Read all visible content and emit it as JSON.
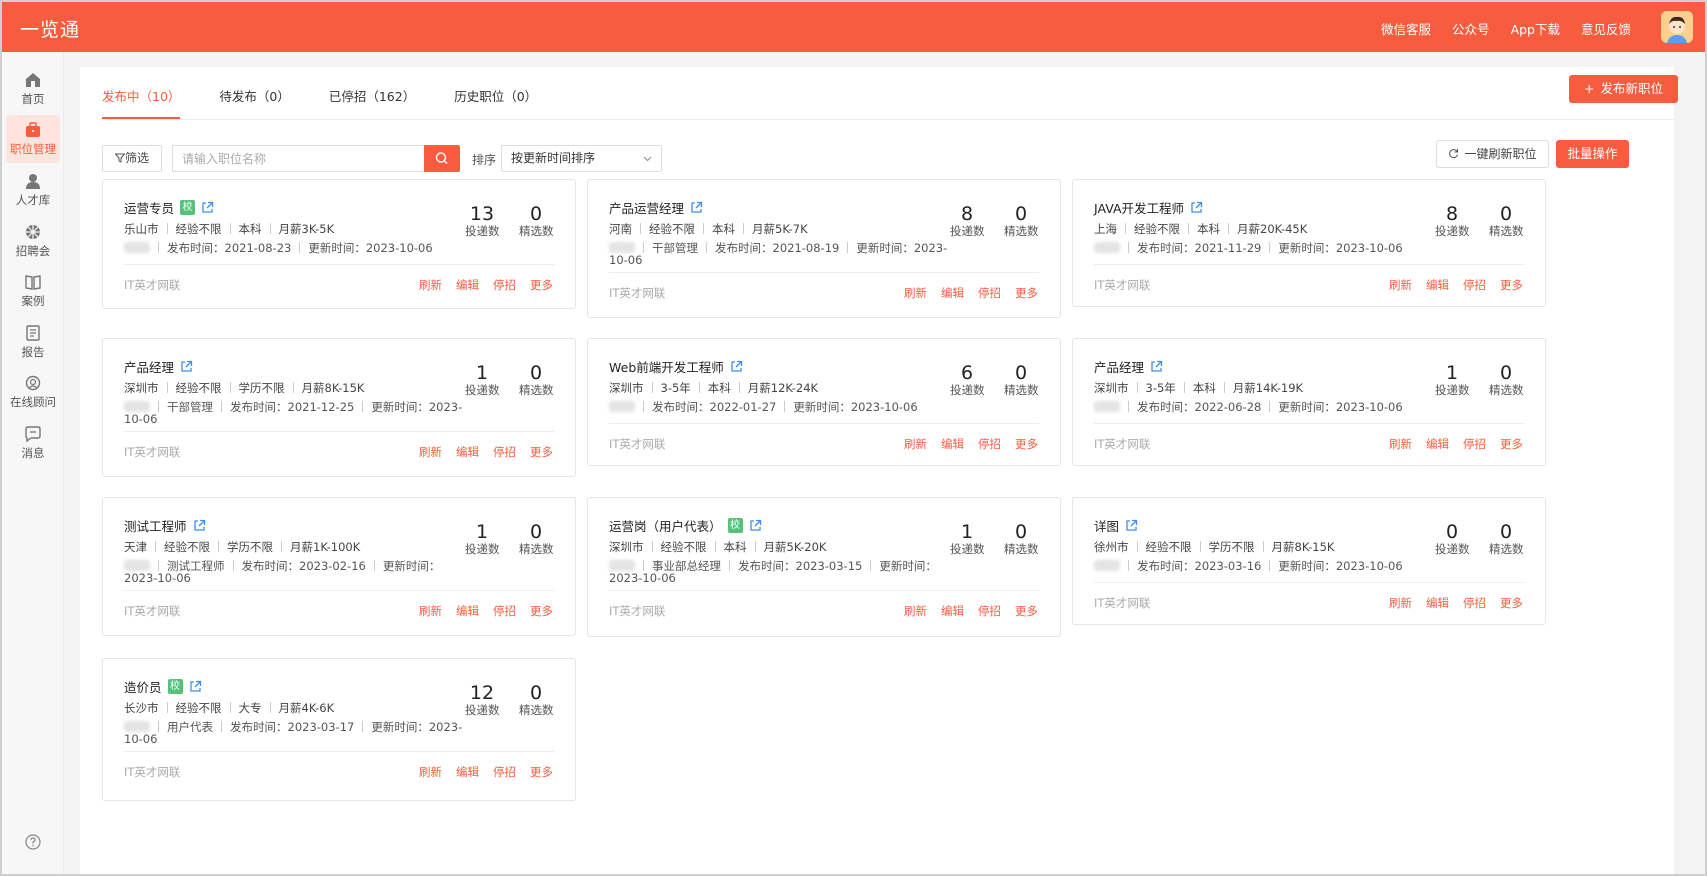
{
  "app": {
    "title": "一览通"
  },
  "header": {
    "links": [
      "微信客服",
      "公众号",
      "App下载",
      "意见反馈"
    ]
  },
  "sidebar": {
    "items": [
      {
        "label": "首页",
        "icon": "home-icon"
      },
      {
        "label": "职位管理",
        "icon": "briefcase-icon"
      },
      {
        "label": "人才库",
        "icon": "user-icon"
      },
      {
        "label": "招聘会",
        "icon": "fair-icon"
      },
      {
        "label": "案例",
        "icon": "book-icon"
      },
      {
        "label": "报告",
        "icon": "report-icon"
      },
      {
        "label": "在线顾问",
        "icon": "advisor-icon"
      },
      {
        "label": "消息",
        "icon": "message-icon"
      }
    ],
    "active": "职位管理"
  },
  "tabs": [
    {
      "label": "发布中（10）",
      "active": true
    },
    {
      "label": "待发布（0）"
    },
    {
      "label": "已停招（162）"
    },
    {
      "label": "历史职位（0）"
    }
  ],
  "toolbar": {
    "publish": "发布新职位",
    "filter": "筛选",
    "search_placeholder": "请输入职位名称",
    "sort_label": "排序",
    "sort_value": "按更新时间排序",
    "refresh_all": "一键刷新职位",
    "batch": "批量操作"
  },
  "colors": {
    "brand": "#f75c3f",
    "badge": "#56c17b"
  },
  "labels": {
    "applies": "投递数",
    "selected": "精选数"
  },
  "card_actions": [
    "刷新",
    "编辑",
    "停招",
    "更多"
  ],
  "jobs": [
    {
      "title": "运营专员",
      "school": "校",
      "city": "乐山市",
      "exp": "经验不限",
      "edu": "本科",
      "salary": "月薪3K-5K",
      "dept": "",
      "publish": "发布时间：2021-08-23",
      "update": "更新时间：2023-10-06",
      "applies": "13",
      "selected": "0",
      "source": "IT英才网联"
    },
    {
      "title": "产品运营经理",
      "school": "",
      "city": "河南",
      "exp": "经验不限",
      "edu": "本科",
      "salary": "月薪5K-7K",
      "dept": "干部管理",
      "publish": "发布时间：2021-08-19",
      "update": "更新时间：2023-10-06",
      "applies": "8",
      "selected": "0",
      "source": "IT英才网联"
    },
    {
      "title": "JAVA开发工程师",
      "school": "",
      "city": "上海",
      "exp": "经验不限",
      "edu": "本科",
      "salary": "月薪20K-45K",
      "dept": "",
      "publish": "发布时间：2021-11-29",
      "update": "更新时间：2023-10-06",
      "applies": "8",
      "selected": "0",
      "source": "IT英才网联"
    },
    {
      "title": "产品经理",
      "school": "",
      "city": "深圳市",
      "exp": "经验不限",
      "edu": "学历不限",
      "salary": "月薪8K-15K",
      "dept": "干部管理",
      "publish": "发布时间：2021-12-25",
      "update": "更新时间：2023-10-06",
      "applies": "1",
      "selected": "0",
      "source": "IT英才网联"
    },
    {
      "title": "Web前端开发工程师",
      "school": "",
      "city": "深圳市",
      "exp": "3-5年",
      "edu": "本科",
      "salary": "月薪12K-24K",
      "dept": "",
      "publish": "发布时间：2022-01-27",
      "update": "更新时间：2023-10-06",
      "applies": "6",
      "selected": "0",
      "source": "IT英才网联"
    },
    {
      "title": "产品经理",
      "school": "",
      "city": "深圳市",
      "exp": "3-5年",
      "edu": "本科",
      "salary": "月薪14K-19K",
      "dept": "",
      "publish": "发布时间：2022-06-28",
      "update": "更新时间：2023-10-06",
      "applies": "1",
      "selected": "0",
      "source": "IT英才网联"
    },
    {
      "title": "测试工程师",
      "school": "",
      "city": "天津",
      "exp": "经验不限",
      "edu": "学历不限",
      "salary": "月薪1K-100K",
      "dept": "测试工程师",
      "publish": "发布时间：2023-02-16",
      "update": "更新时间：2023-10-06",
      "applies": "1",
      "selected": "0",
      "source": "IT英才网联"
    },
    {
      "title": "运营岗（用户代表）",
      "school": "校",
      "city": "深圳市",
      "exp": "经验不限",
      "edu": "本科",
      "salary": "月薪5K-20K",
      "dept": "事业部总经理",
      "publish": "发布时间：2023-03-15",
      "update": "更新时间：2023-10-06",
      "applies": "1",
      "selected": "0",
      "source": "IT英才网联"
    },
    {
      "title": "详图",
      "school": "",
      "city": "徐州市",
      "exp": "经验不限",
      "edu": "学历不限",
      "salary": "月薪8K-15K",
      "dept": "",
      "publish": "发布时间：2023-03-16",
      "update": "更新时间：2023-10-06",
      "applies": "0",
      "selected": "0",
      "source": "IT英才网联"
    },
    {
      "title": "造价员",
      "school": "校",
      "city": "长沙市",
      "exp": "经验不限",
      "edu": "大专",
      "salary": "月薪4K-6K",
      "dept": "用户代表",
      "publish": "发布时间：2023-03-17",
      "update": "更新时间：2023-10-06",
      "applies": "12",
      "selected": "0",
      "source": "IT英才网联"
    }
  ]
}
